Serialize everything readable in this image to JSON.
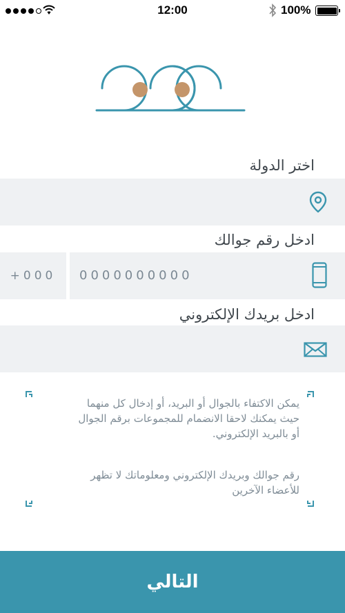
{
  "status_bar": {
    "time": "12:00",
    "battery_percent": "100%",
    "signal_dots_filled": 4,
    "signal_dots_total": 5,
    "icons": [
      "signal-icon",
      "wifi-icon",
      "bluetooth-icon",
      "battery-icon"
    ]
  },
  "logo": {
    "icon": "logo-icon",
    "colors": {
      "line": "#3a95ad",
      "dots": "#c4956a"
    }
  },
  "country": {
    "label": "اختر الدولة",
    "value": "",
    "icon": "location-pin-icon"
  },
  "phone": {
    "label": "ادخل رقم جوالك",
    "country_code": "+000",
    "number": "0000000000",
    "icon": "mobile-phone-icon"
  },
  "email": {
    "label": "ادخل بريدك الإلكتروني",
    "value": "",
    "icon": "envelope-icon"
  },
  "info": {
    "paragraph_1_line_1": "يمكن الاكتفاء بالجوال أو البريد، أو إدخال كل منهما",
    "paragraph_1_line_2": "حيث يمكنك لاحقا الانضمام للمجموعات برقم الجوال",
    "paragraph_1_line_3": "أو بالبريد الإلكتروني.",
    "paragraph_2_line_1": "رقم جوالك وبريدك الإلكتروني ومعلوماتك لا تظهر",
    "paragraph_2_line_2": "للأعضاء الآخرين"
  },
  "next_button": {
    "label": "التالي"
  },
  "colors": {
    "accent": "#3a95ad",
    "field_background": "#eff1f3",
    "label_text": "#40474d",
    "placeholder_text": "#7b8893"
  }
}
